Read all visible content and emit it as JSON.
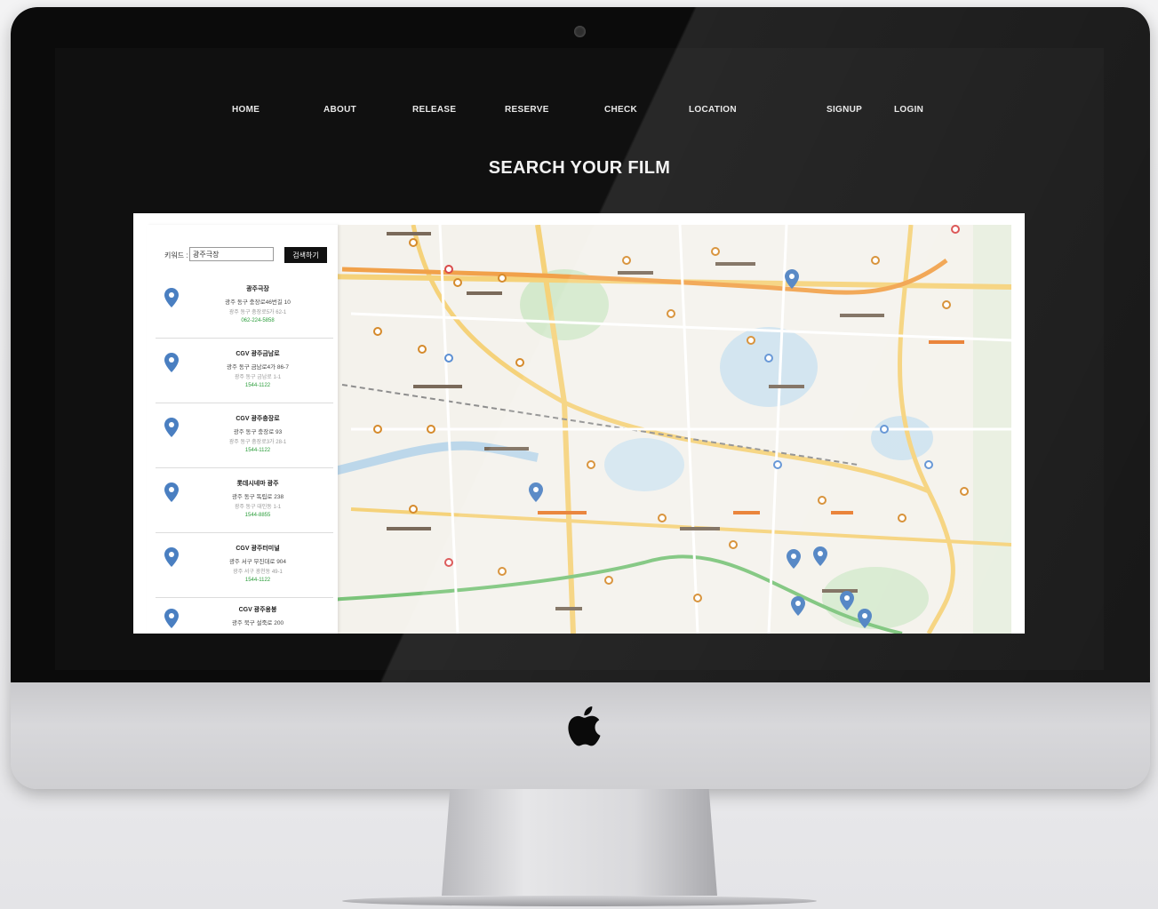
{
  "nav": {
    "items": [
      "HOME",
      "ABOUT",
      "RELEASE",
      "RESERVE",
      "CHECK",
      "LOCATION",
      "SIGNUP",
      "LOGIN"
    ]
  },
  "page": {
    "title": "SEARCH YOUR FILM"
  },
  "map_search": {
    "label": "키워드 :",
    "value": "광주극장",
    "button_label": "검색하기"
  },
  "theater_list": [
    {
      "name": "광주극장",
      "address": "광주 동구 충장로46번길 10",
      "sub": "광주 동구 충장로5가 62-1",
      "tel": "062-224-5858"
    },
    {
      "name": "CGV 광주금남로",
      "address": "광주 동구 금남로4가 86-7",
      "sub": "광주 동구 금남로 1-1",
      "tel": "1544-1122"
    },
    {
      "name": "CGV 광주충장로",
      "address": "광주 동구 충장로 93",
      "sub": "광주 동구 충장로3가 28-1",
      "tel": "1544-1122"
    },
    {
      "name": "롯데시네마 광주",
      "address": "광주 동구 독립로 238",
      "sub": "광주 동구 대인동 1-1",
      "tel": "1544-8855"
    },
    {
      "name": "CGV 광주터미널",
      "address": "광주 서구 무진대로 904",
      "sub": "광주 서구 광천동 49-1",
      "tel": "1544-1122"
    },
    {
      "name": "CGV 광주용봉",
      "address": "광주 북구 설죽로 200",
      "sub": "",
      "tel": ""
    }
  ],
  "colors": {
    "bezel": "#0b0b0b",
    "screen_bg": "#101010",
    "nav_text": "#e8e8e8",
    "marker": "#4a7fc1",
    "tel_green": "#2a9d3a"
  },
  "icons": {
    "brand": "apple-logo-icon",
    "camera": "webcam-icon",
    "marker": "map-marker-icon"
  }
}
